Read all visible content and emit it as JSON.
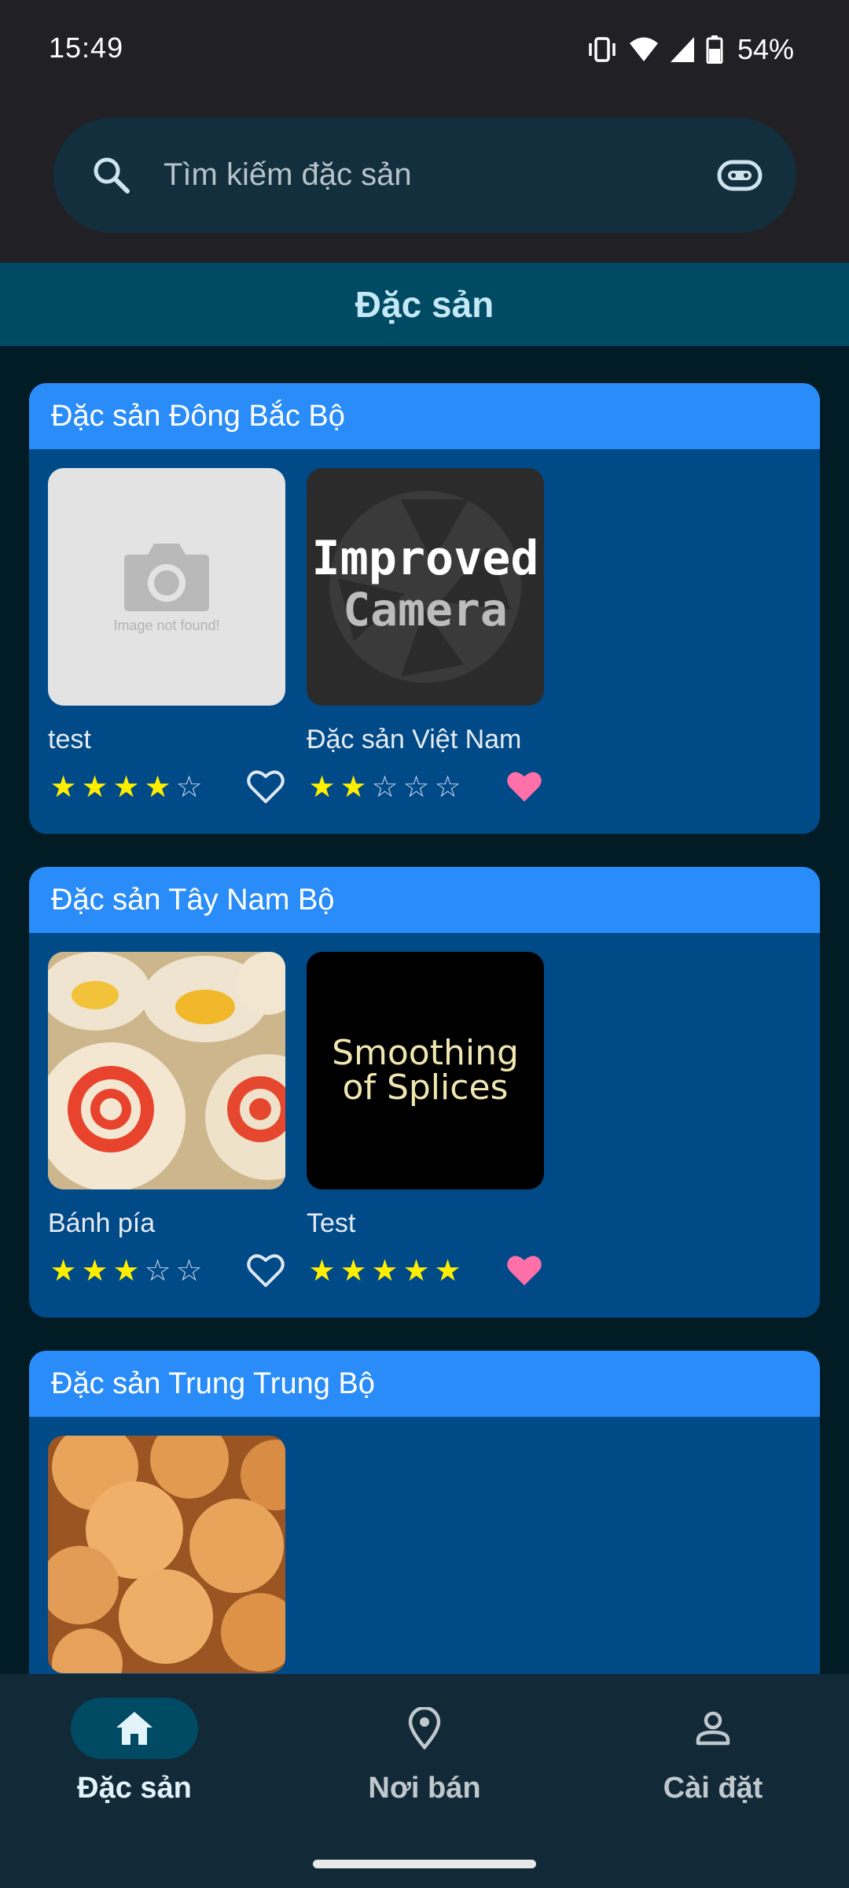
{
  "status_bar": {
    "time": "15:49",
    "battery": "54%",
    "icons": [
      "vibrate-icon",
      "wifi-icon",
      "signal-icon",
      "battery-icon"
    ]
  },
  "search": {
    "placeholder": "Tìm kiếm đặc sản",
    "value": "",
    "left_icon": "search-icon",
    "right_icon": "google-lens-icon"
  },
  "page_title": "Đặc sản",
  "categories": [
    {
      "title": "Đặc sản Đông Bắc Bộ",
      "items": [
        {
          "name": "test",
          "rating": 4,
          "max_rating": 5,
          "favorite": false,
          "image": "Image not found!"
        },
        {
          "name": "Đặc sản Việt Nam",
          "rating": 2,
          "max_rating": 5,
          "favorite": true,
          "image": {
            "line1": "Improved",
            "line2": "Camera"
          }
        }
      ]
    },
    {
      "title": "Đặc sản Tây Nam Bộ",
      "items": [
        {
          "name": "Bánh pía",
          "rating": 3,
          "max_rating": 5,
          "favorite": false,
          "image": "mooncake-photo"
        },
        {
          "name": "Test",
          "rating": 5,
          "max_rating": 5,
          "favorite": true,
          "image": {
            "line1": "Smoothing",
            "line2": "of Splices"
          }
        }
      ]
    },
    {
      "title": "Đặc sản Trung Trung Bộ",
      "items": [
        {
          "name": "",
          "image": "coconut-cookie-photo"
        }
      ]
    }
  ],
  "bottom_nav": {
    "items": [
      {
        "label": "Đặc sản",
        "icon": "home-icon",
        "active": true
      },
      {
        "label": "Nơi bán",
        "icon": "location-pin-icon",
        "active": false
      },
      {
        "label": "Cài đặt",
        "icon": "person-icon",
        "active": false
      }
    ]
  },
  "colors": {
    "background": "#021c26",
    "category_header": "#2a8cf8",
    "category_body": "#004a88",
    "star_full": "#ffee00",
    "heart_active": "#ff6fa8"
  }
}
